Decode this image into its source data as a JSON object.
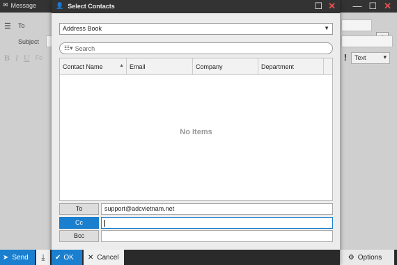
{
  "background": {
    "window_title": "Message",
    "to_label": "To",
    "subject_label": "Subject",
    "format_bold": "B",
    "format_italic": "I",
    "format_underline": "U",
    "format_font_fragment": "Fo",
    "importance_glyph": "!",
    "text_format": "Text",
    "add_glyph": "+",
    "send_label": "Send",
    "options_label": "Options",
    "colors": {
      "accent": "#1a7fcf",
      "titlebar": "#333333",
      "close": "#e85050"
    }
  },
  "dialog": {
    "title": "Select Contacts",
    "address_book": "Address Book",
    "search_placeholder": "Search",
    "columns": [
      "Contact Name",
      "Email",
      "Company",
      "Department"
    ],
    "empty_text": "No Items",
    "recipients": [
      {
        "label": "To",
        "value": "support@adcvietnam.net",
        "active": false
      },
      {
        "label": "Cc",
        "value": "",
        "active": true
      },
      {
        "label": "Bcc",
        "value": "",
        "active": false
      }
    ],
    "ok_label": "OK",
    "cancel_label": "Cancel"
  }
}
